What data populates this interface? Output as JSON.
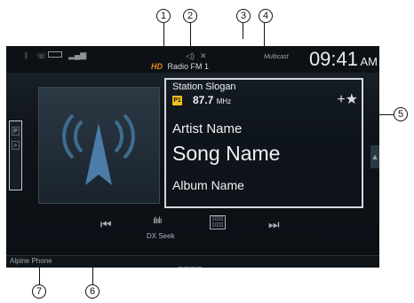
{
  "callouts": [
    "1",
    "2",
    "3",
    "4",
    "5",
    "6",
    "7"
  ],
  "status": {
    "time": "09:41",
    "ampm": "AM",
    "multicast": "Multicast",
    "source_badge": "HD",
    "source": "Radio FM 1",
    "icons": [
      "bluetooth-icon",
      "battery-icon",
      "signal-icon",
      "volume-icon",
      "mute-icon"
    ]
  },
  "station": {
    "slogan": "Station Slogan",
    "preset": "P1",
    "frequency": "87.7",
    "unit": "MHz",
    "favorite": "+★"
  },
  "track": {
    "artist": "Artist Name",
    "song": "Song Name",
    "album": "Album Name"
  },
  "controls": {
    "prev": "⏮",
    "dx_seek_label": "DX Seek",
    "next": "⏭"
  },
  "sidebar": {
    "p": "P",
    "search": "⌕"
  },
  "footer": {
    "app": "Alpine Phone"
  }
}
